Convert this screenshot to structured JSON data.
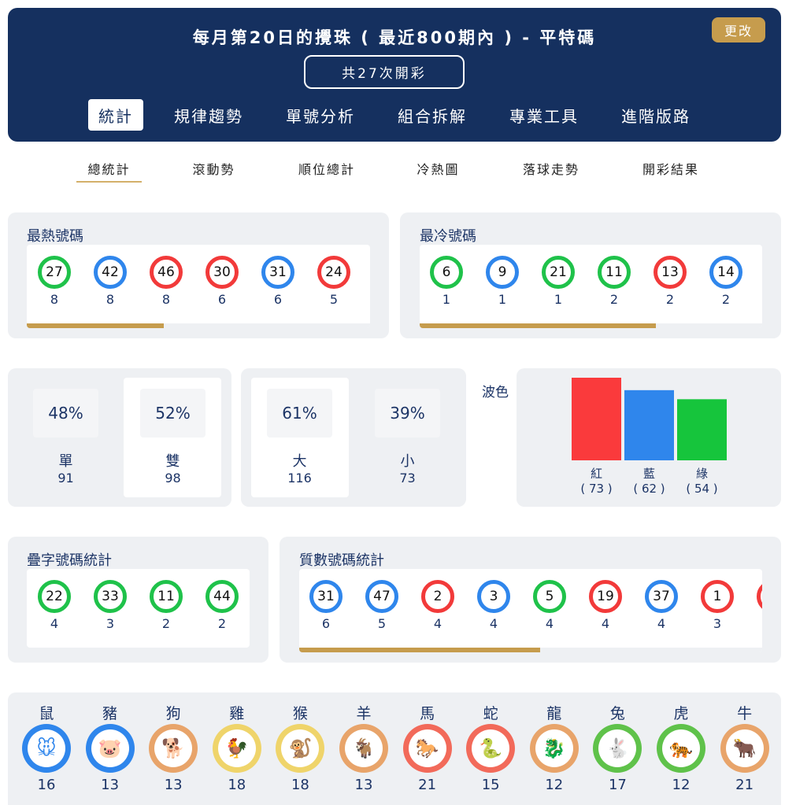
{
  "header": {
    "title": "每月第20日的攪珠 ( 最近800期內 ) - 平特碼",
    "change_label": "更改",
    "count_label": "共27次開彩",
    "tabs": [
      "統計",
      "規律趨勢",
      "單號分析",
      "組合拆解",
      "專業工具",
      "進階版路"
    ]
  },
  "sub_tabs": [
    "總統計",
    "滾動勢",
    "順位總計",
    "冷熱圖",
    "落球走勢",
    "開彩結果"
  ],
  "hot": {
    "title": "最熱號碼",
    "progress": 0.4,
    "balls": [
      {
        "num": "27",
        "color": "green",
        "count": "8"
      },
      {
        "num": "42",
        "color": "blue",
        "count": "8"
      },
      {
        "num": "46",
        "color": "red",
        "count": "8"
      },
      {
        "num": "30",
        "color": "red",
        "count": "6"
      },
      {
        "num": "31",
        "color": "blue",
        "count": "6"
      },
      {
        "num": "24",
        "color": "red",
        "count": "5"
      }
    ]
  },
  "cold": {
    "title": "最冷號碼",
    "progress": 0.69,
    "balls": [
      {
        "num": "6",
        "color": "green",
        "count": "1"
      },
      {
        "num": "9",
        "color": "blue",
        "count": "1"
      },
      {
        "num": "21",
        "color": "green",
        "count": "1"
      },
      {
        "num": "11",
        "color": "green",
        "count": "2"
      },
      {
        "num": "13",
        "color": "red",
        "count": "2"
      },
      {
        "num": "14",
        "color": "blue",
        "count": "2"
      }
    ]
  },
  "odd_even": {
    "odd": {
      "pct": "48%",
      "label": "單",
      "count": "91"
    },
    "even": {
      "pct": "52%",
      "label": "雙",
      "count": "98"
    }
  },
  "big_small": {
    "big": {
      "pct": "61%",
      "label": "大",
      "count": "116"
    },
    "small": {
      "pct": "39%",
      "label": "小",
      "count": "73"
    }
  },
  "wave": {
    "label": "波色",
    "chart_data": {
      "type": "bar",
      "categories": [
        "紅",
        "藍",
        "綠"
      ],
      "values": [
        73,
        62,
        54
      ],
      "value_labels": [
        "( 73 )",
        "( 62 )",
        "( 54 )"
      ],
      "colors": [
        "#fa3a3c",
        "#2f86ec",
        "#16c53c"
      ]
    }
  },
  "repeat": {
    "title": "疊字號碼統計",
    "balls": [
      {
        "num": "22",
        "color": "green",
        "count": "4"
      },
      {
        "num": "33",
        "color": "green",
        "count": "3"
      },
      {
        "num": "11",
        "color": "green",
        "count": "2"
      },
      {
        "num": "44",
        "color": "green",
        "count": "2"
      }
    ]
  },
  "prime": {
    "title": "質數號碼統計",
    "progress": 0.52,
    "balls": [
      {
        "num": "31",
        "color": "blue",
        "count": "6"
      },
      {
        "num": "47",
        "color": "blue",
        "count": "5"
      },
      {
        "num": "2",
        "color": "red",
        "count": "4"
      },
      {
        "num": "3",
        "color": "blue",
        "count": "4"
      },
      {
        "num": "5",
        "color": "green",
        "count": "4"
      },
      {
        "num": "19",
        "color": "red",
        "count": "4"
      },
      {
        "num": "37",
        "color": "blue",
        "count": "4"
      },
      {
        "num": "1",
        "color": "red",
        "count": "3"
      },
      {
        "num": "",
        "color": "red",
        "count": ""
      }
    ]
  },
  "zodiac": [
    {
      "name": "鼠",
      "count": "16",
      "color": "#2f86ec",
      "icon": "rat-icon"
    },
    {
      "name": "豬",
      "count": "13",
      "color": "#2f86ec",
      "icon": "pig-icon"
    },
    {
      "name": "狗",
      "count": "13",
      "color": "#e8a46a",
      "icon": "dog-icon"
    },
    {
      "name": "雞",
      "count": "18",
      "color": "#efd46a",
      "icon": "rooster-icon"
    },
    {
      "name": "猴",
      "count": "18",
      "color": "#efd46a",
      "icon": "monkey-icon"
    },
    {
      "name": "羊",
      "count": "13",
      "color": "#e8a46a",
      "icon": "goat-icon"
    },
    {
      "name": "馬",
      "count": "21",
      "color": "#f26a5a",
      "icon": "horse-icon"
    },
    {
      "name": "蛇",
      "count": "15",
      "color": "#f26a5a",
      "icon": "snake-icon"
    },
    {
      "name": "龍",
      "count": "12",
      "color": "#e8a46a",
      "icon": "dragon-icon"
    },
    {
      "name": "兔",
      "count": "17",
      "color": "#5fc24a",
      "icon": "rabbit-icon"
    },
    {
      "name": "虎",
      "count": "12",
      "color": "#5fc24a",
      "icon": "tiger-icon"
    },
    {
      "name": "牛",
      "count": "21",
      "color": "#e8a46a",
      "icon": "ox-icon"
    }
  ]
}
